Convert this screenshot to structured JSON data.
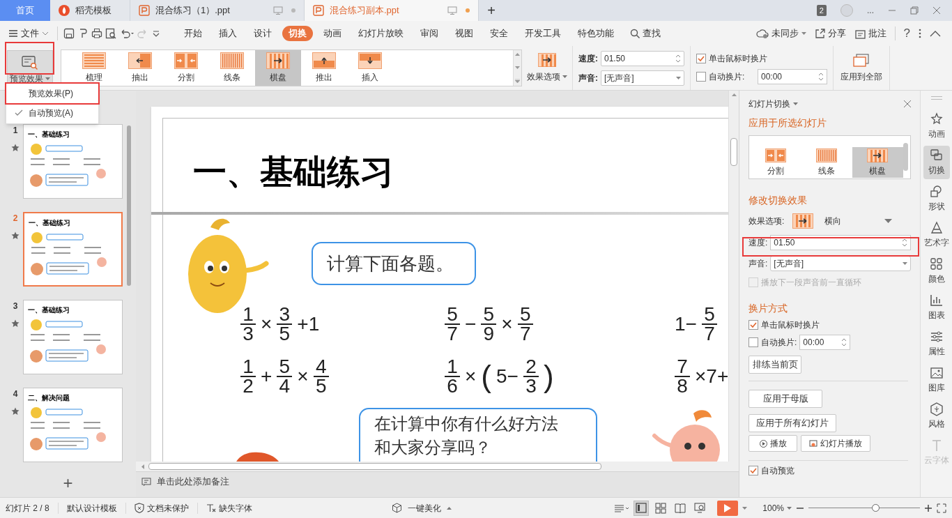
{
  "app_tabs": [
    {
      "label": "首页",
      "kind": "home",
      "selected": false
    },
    {
      "label": "稻壳模板",
      "kind": "docer",
      "selected": false
    },
    {
      "label": "混合练习（1）.ppt",
      "kind": "doc",
      "selected": false
    },
    {
      "label": "混合练习副本.ppt",
      "kind": "doc",
      "selected": true
    }
  ],
  "window_badge": "2",
  "window_more": "...",
  "new_tab": "+",
  "file_menu": "文件",
  "ribbon_tabs": [
    {
      "label": "开始",
      "selected": false
    },
    {
      "label": "插入",
      "selected": false
    },
    {
      "label": "设计",
      "selected": false
    },
    {
      "label": "切换",
      "selected": true
    },
    {
      "label": "动画",
      "selected": false
    },
    {
      "label": "幻灯片放映",
      "selected": false
    },
    {
      "label": "审阅",
      "selected": false
    },
    {
      "label": "视图",
      "selected": false
    },
    {
      "label": "安全",
      "selected": false
    },
    {
      "label": "开发工具",
      "selected": false
    },
    {
      "label": "特色功能",
      "selected": false
    }
  ],
  "search_tab": "查找",
  "sync": "未同步",
  "share": "分享",
  "comment": "批注",
  "help": "?",
  "preview_button": "预览效果",
  "preview_menu": [
    {
      "label": "预览效果(P)",
      "checked": false,
      "highlighted": true
    },
    {
      "label": "自动预览(A)",
      "checked": true,
      "highlighted": false
    }
  ],
  "effects": [
    {
      "label": "梳理",
      "kind": "comb",
      "selected": false
    },
    {
      "label": "抽出",
      "kind": "pull",
      "selected": false
    },
    {
      "label": "分割",
      "kind": "split",
      "selected": false
    },
    {
      "label": "线条",
      "kind": "stripes",
      "selected": false
    },
    {
      "label": "棋盘",
      "kind": "checker",
      "selected": true
    },
    {
      "label": "推出",
      "kind": "push",
      "selected": false
    },
    {
      "label": "插入",
      "kind": "cover",
      "selected": false
    }
  ],
  "effect_options": "效果选项",
  "speed": {
    "label": "速度:",
    "value": "01.50"
  },
  "sound": {
    "label": "声音:",
    "value": "[无声音]"
  },
  "on_click": {
    "label": "单击鼠标时换片",
    "checked": true
  },
  "auto_advance": {
    "label": "自动换片:",
    "checked": false,
    "value": "00:00"
  },
  "apply_all": "应用到全部",
  "thumbnails": [
    {
      "number": "1",
      "title": "一、基础练习",
      "selected": false
    },
    {
      "number": "2",
      "title": "一、基础练习",
      "selected": true
    },
    {
      "number": "3",
      "title": "一、基础练习",
      "selected": false
    },
    {
      "number": "4",
      "title": "二、解决问题",
      "selected": false
    }
  ],
  "add_slide": "+",
  "slide": {
    "title": "一、基础练习",
    "bubble_1": "计算下面各题。",
    "bubble_2": "在计算中你有什么好方法和大家分享吗？",
    "rows": [
      [
        [
          {
            "kind": "frac",
            "num": "1",
            "den": "3"
          },
          {
            "kind": "op",
            "text": "×"
          },
          {
            "kind": "frac",
            "num": "3",
            "den": "5"
          },
          {
            "kind": "op",
            "text": "+1"
          }
        ],
        [
          {
            "kind": "frac",
            "num": "5",
            "den": "7"
          },
          {
            "kind": "op",
            "text": "−"
          },
          {
            "kind": "frac",
            "num": "5",
            "den": "9"
          },
          {
            "kind": "op",
            "text": "×"
          },
          {
            "kind": "frac",
            "num": "5",
            "den": "7"
          }
        ],
        [
          {
            "kind": "op",
            "text": "1−"
          },
          {
            "kind": "frac",
            "num": "5",
            "den": "7"
          }
        ]
      ],
      [
        [
          {
            "kind": "frac",
            "num": "1",
            "den": "2"
          },
          {
            "kind": "op",
            "text": "+"
          },
          {
            "kind": "frac",
            "num": "5",
            "den": "4"
          },
          {
            "kind": "op",
            "text": "×"
          },
          {
            "kind": "frac",
            "num": "4",
            "den": "5"
          }
        ],
        [
          {
            "kind": "frac",
            "num": "1",
            "den": "6"
          },
          {
            "kind": "op",
            "text": "×"
          },
          {
            "kind": "paren",
            "text": "("
          },
          {
            "kind": "op",
            "text": "5−"
          },
          {
            "kind": "frac",
            "num": "2",
            "den": "3"
          },
          {
            "kind": "paren",
            "text": ")"
          }
        ],
        [
          {
            "kind": "frac",
            "num": "7",
            "den": "8"
          },
          {
            "kind": "op",
            "text": "×7+"
          }
        ]
      ]
    ]
  },
  "notes_placeholder": "单击此处添加备注",
  "panel": {
    "title": "幻灯片切换",
    "heading_apply": "应用于所选幻灯片",
    "gallery": [
      {
        "label": "分割",
        "kind": "split",
        "selected": false
      },
      {
        "label": "线条",
        "kind": "stripes",
        "selected": false
      },
      {
        "label": "棋盘",
        "kind": "checker",
        "selected": true
      }
    ],
    "heading_modify": "修改切换效果",
    "effect_options_label": "效果选项:",
    "direction": "横向",
    "speed": {
      "label": "速度:",
      "value": "01.50"
    },
    "sound": {
      "label": "声音:",
      "value": "[无声音]"
    },
    "loop": {
      "label": "播放下一段声音前一直循环",
      "checked": false,
      "disabled": true
    },
    "heading_advance": "换片方式",
    "on_click": {
      "label": "单击鼠标时换片",
      "checked": true
    },
    "auto_advance": {
      "label": "自动换片:",
      "checked": false,
      "value": "00:00"
    },
    "rehearse": "排练当前页",
    "apply_master": "应用于母版",
    "apply_all": "应用于所有幻灯片",
    "play": "播放",
    "slideshow": "幻灯片播放",
    "auto_preview": {
      "label": "自动预览",
      "checked": true
    }
  },
  "sidebar": [
    {
      "label": "动画",
      "kind": "animation",
      "selected": false,
      "disabled": false
    },
    {
      "label": "切换",
      "kind": "transition",
      "selected": true,
      "disabled": false
    },
    {
      "label": "形状",
      "kind": "shape",
      "selected": false,
      "disabled": false
    },
    {
      "label": "艺术字",
      "kind": "wordart",
      "selected": false,
      "disabled": false
    },
    {
      "label": "颜色",
      "kind": "color",
      "selected": false,
      "disabled": false
    },
    {
      "label": "图表",
      "kind": "chart",
      "selected": false,
      "disabled": false
    },
    {
      "label": "属性",
      "kind": "props",
      "selected": false,
      "disabled": false
    },
    {
      "label": "图库",
      "kind": "gallery",
      "selected": false,
      "disabled": false
    },
    {
      "label": "风格",
      "kind": "style",
      "selected": false,
      "disabled": false
    },
    {
      "label": "云字体",
      "kind": "font",
      "selected": false,
      "disabled": true
    }
  ],
  "status_bar": {
    "slide_counter": "幻灯片 2 / 8",
    "template": "默认设计模板",
    "protection": "文档未保护",
    "missing_fonts": "缺失字体",
    "beautify": "一键美化",
    "views": [
      {
        "kind": "normal",
        "selected": true
      },
      {
        "kind": "sorter",
        "selected": false
      },
      {
        "kind": "reading",
        "selected": false
      },
      {
        "kind": "presenter",
        "selected": false
      }
    ],
    "zoom": "100%",
    "zoom_slider": {
      "level": 0.6
    }
  }
}
